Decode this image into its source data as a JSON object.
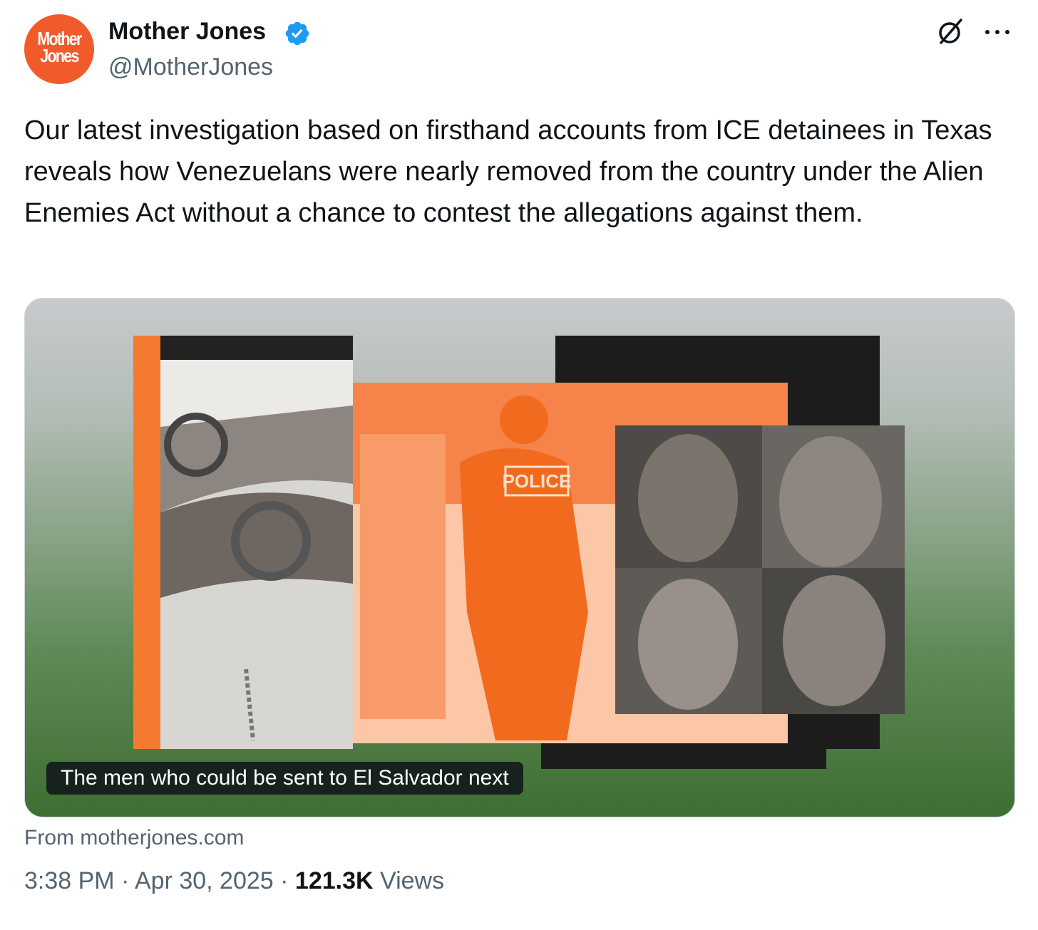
{
  "account": {
    "avatar_text_line1": "Mother",
    "avatar_text_line2": "Jones",
    "display_name": "Mother Jones",
    "handle": "@MotherJones",
    "verified": true
  },
  "header_icons": [
    "grok-icon",
    "more-options-icon"
  ],
  "tweet": {
    "text": "Our latest investigation based on firsthand accounts from ICE detainees in Texas reveals how Venezuelans were nearly removed from the country under the Alien Enemies Act without a chance to contest the allegations against them."
  },
  "card": {
    "caption": "The men who could be sent to El Salvador next",
    "source": "From motherjones.com",
    "image_text": "POLICE"
  },
  "meta": {
    "time": "3:38 PM",
    "separator": "·",
    "date": "Apr 30, 2025",
    "views_count": "121.3K",
    "views_label": "Views"
  },
  "colors": {
    "brand_orange": "#f15a2b",
    "verified_blue": "#1d9bf0",
    "text_primary": "#0f1419",
    "text_secondary": "#536471"
  }
}
